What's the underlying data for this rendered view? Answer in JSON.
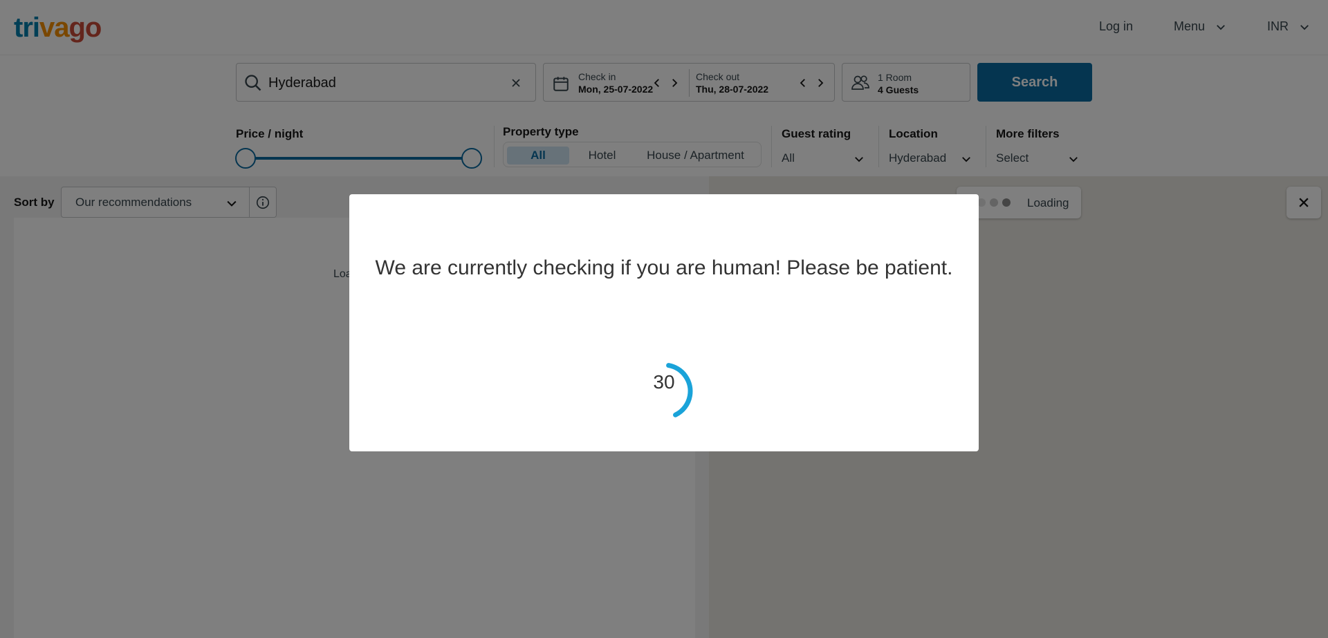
{
  "header": {
    "logo": {
      "part1": "tri",
      "part2": "va",
      "part3": "go"
    },
    "login": "Log in",
    "menu": "Menu",
    "currency": "INR"
  },
  "search": {
    "destination": "Hyderabad",
    "checkin_label": "Check in",
    "checkin_value": "Mon, 25-07-2022",
    "checkout_label": "Check out",
    "checkout_value": "Thu, 28-07-2022",
    "rooms": "1 Room",
    "guests": "4 Guests",
    "button": "Search"
  },
  "filters": {
    "price_label": "Price / night",
    "property_type_label": "Property type",
    "property_types": [
      "All",
      "Hotel",
      "House / Apartment"
    ],
    "property_type_selected": "All",
    "guest_rating_label": "Guest rating",
    "guest_rating_value": "All",
    "location_label": "Location",
    "location_value": "Hyderabad",
    "more_filters_label": "More filters",
    "more_filters_value": "Select"
  },
  "results": {
    "sort_label": "Sort by",
    "sort_value": "Our recommendations",
    "loading_text": "Loa"
  },
  "map": {
    "loading_text": "Loading"
  },
  "modal": {
    "message": "We are currently checking if you are human! Please be patient.",
    "countdown": "30",
    "progress_fraction": 0.4
  },
  "colors": {
    "brand_blue": "#0a6aa0",
    "spinner": "#1aa3d9",
    "logo_blue": "#007fad",
    "logo_orange": "#f48f00",
    "logo_red": "#c94a38"
  }
}
